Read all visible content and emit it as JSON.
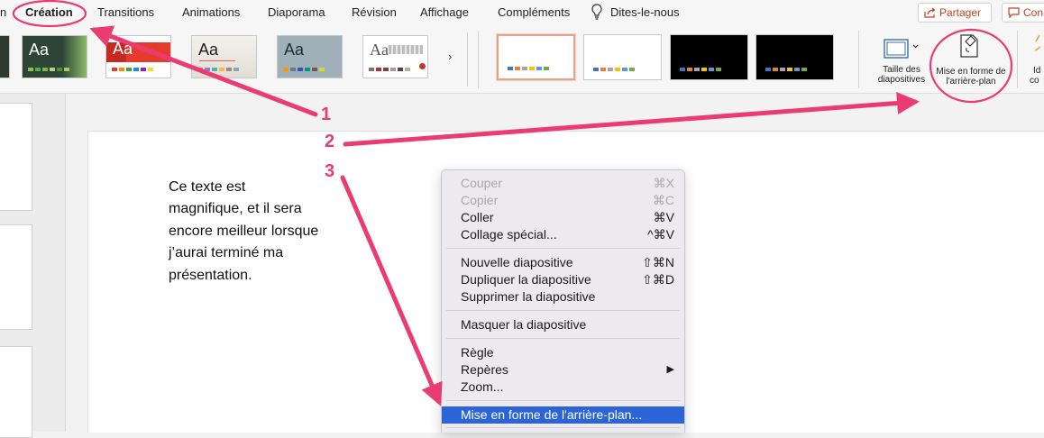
{
  "menu": {
    "tabs": [
      "n",
      "Création",
      "Transitions",
      "Animations",
      "Diaporama",
      "Révision",
      "Affichage",
      "Compléments"
    ],
    "tell_me": "Dites-le-nous",
    "share": "Partager",
    "comments": "Con"
  },
  "ribbon": {
    "theme_aa": "Aa",
    "more": "›",
    "slide_size": "Taille des diapositives",
    "format_background": "Mise en forme de l'arrière-plan",
    "ideas": "Id",
    "ideas2": "co"
  },
  "slide": {
    "text": "Ce texte est magnifique, et il sera encore meilleur lorsque j’aurai terminé ma présentation."
  },
  "context_menu": {
    "items": [
      {
        "label": "Couper",
        "shortcut": "⌘X"
      },
      {
        "label": "Copier",
        "shortcut": "⌘C"
      },
      {
        "label": "Coller",
        "shortcut": "⌘V"
      },
      {
        "label": "Collage spécial...",
        "shortcut": "^⌘V"
      },
      {
        "label": "Nouvelle diapositive",
        "shortcut": "⇧⌘N"
      },
      {
        "label": "Dupliquer la diapositive",
        "shortcut": "⇧⌘D"
      },
      {
        "label": "Supprimer la diapositive",
        "shortcut": ""
      },
      {
        "label": "Masquer la diapositive",
        "shortcut": ""
      },
      {
        "label": "Règle",
        "shortcut": ""
      },
      {
        "label": "Repères",
        "shortcut": "▶"
      },
      {
        "label": "Zoom...",
        "shortcut": ""
      },
      {
        "label": "Mise en forme de l'arrière-plan...",
        "shortcut": ""
      }
    ]
  },
  "annotations": {
    "step1": "1",
    "step2": "2",
    "step3": "3"
  },
  "colors": {
    "highlight": "#2a64d7",
    "annotation": "#ea3c73",
    "share": "#c43e1c"
  }
}
